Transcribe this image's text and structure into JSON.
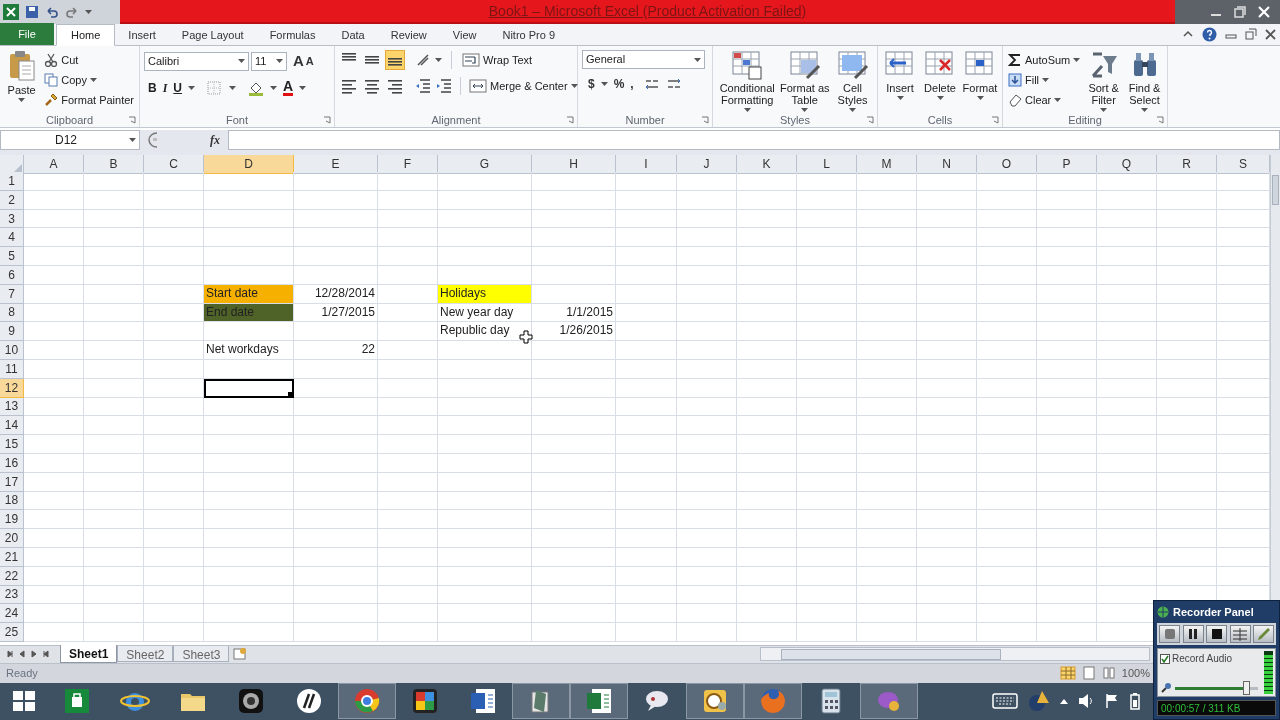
{
  "window": {
    "title": "Book1 – Microsoft Excel (Product Activation Failed)"
  },
  "tabs": [
    {
      "label": "File",
      "kind": "file",
      "selected": false
    },
    {
      "label": "Home",
      "kind": "tab",
      "selected": true
    },
    {
      "label": "Insert",
      "kind": "tab",
      "selected": false
    },
    {
      "label": "Page Layout",
      "kind": "tab",
      "selected": false
    },
    {
      "label": "Formulas",
      "kind": "tab",
      "selected": false
    },
    {
      "label": "Data",
      "kind": "tab",
      "selected": false
    },
    {
      "label": "Review",
      "kind": "tab",
      "selected": false
    },
    {
      "label": "View",
      "kind": "tab",
      "selected": false
    },
    {
      "label": "Nitro Pro 9",
      "kind": "tab",
      "selected": false
    }
  ],
  "ribbon": {
    "clipboard": {
      "label": "Clipboard",
      "paste": "Paste",
      "items": [
        "Cut",
        "Copy",
        "Format Painter"
      ]
    },
    "font": {
      "label": "Font",
      "font": "Calibri",
      "size": "11",
      "buttons": [
        {
          "kind": "grow",
          "label": "A"
        },
        {
          "kind": "shrink",
          "label": "A"
        },
        {
          "kind": "bold",
          "label": "B"
        },
        {
          "kind": "italic",
          "label": "I"
        },
        {
          "kind": "underline",
          "label": "U"
        },
        {
          "kind": "color",
          "label": "A"
        }
      ]
    },
    "alignment": {
      "label": "Alignment",
      "vertical": [
        {
          "kind": "top",
          "selected": false
        },
        {
          "kind": "middle",
          "selected": false
        },
        {
          "kind": "bottom",
          "selected": true
        }
      ],
      "wrap": "Wrap Text",
      "merge": "Merge & Center"
    },
    "number": {
      "label": "Number",
      "format": "General",
      "buttons": [
        "$",
        "%",
        ","
      ]
    },
    "styles": {
      "label": "Styles",
      "items": [
        "Conditional Formatting",
        "Format as Table",
        "Cell Styles"
      ]
    },
    "cells": {
      "label": "Cells",
      "items": [
        "Insert",
        "Delete",
        "Format"
      ]
    },
    "editing": {
      "label": "Editing",
      "items": [
        "AutoSum",
        "Fill",
        "Clear"
      ],
      "large": [
        "Sort & Filter",
        "Find & Select"
      ]
    }
  },
  "formula_bar": {
    "name_box": "D12",
    "function": "fx"
  },
  "sheet": {
    "columns": [
      "A",
      "B",
      "C",
      "D",
      "E",
      "F",
      "G",
      "H",
      "I",
      "J",
      "K",
      "L",
      "M",
      "N",
      "O",
      "P",
      "Q",
      "R",
      "S"
    ],
    "rows": [
      {
        "label": "1"
      },
      {
        "label": "2"
      },
      {
        "label": "3"
      },
      {
        "label": "4"
      },
      {
        "label": "5"
      },
      {
        "label": "6"
      },
      {
        "label": "7",
        "cells": {
          "D": {
            "text": "Start date",
            "kind": "text",
            "color": "#f6b100",
            "selected": false
          },
          "E": {
            "text": "12/28/2014",
            "kind": "number",
            "selected": false
          },
          "G": {
            "text": "Holidays",
            "kind": "text",
            "color": "#ffff00",
            "selected": false
          }
        }
      },
      {
        "label": "8",
        "cells": {
          "D": {
            "text": "End date",
            "kind": "text",
            "color": "#4f6228",
            "selected": false
          },
          "E": {
            "text": "1/27/2015",
            "kind": "number",
            "selected": false
          },
          "G": {
            "text": "New year day",
            "kind": "text",
            "selected": false
          },
          "H": {
            "text": "1/1/2015",
            "kind": "number",
            "selected": false
          }
        }
      },
      {
        "label": "9",
        "cells": {
          "G": {
            "text": "Republic day",
            "kind": "text",
            "selected": false
          },
          "H": {
            "text": "1/26/2015",
            "kind": "number",
            "selected": false
          }
        }
      },
      {
        "label": "10",
        "cells": {
          "D": {
            "text": "Net workdays",
            "kind": "text",
            "selected": false
          },
          "E": {
            "text": "22",
            "kind": "number",
            "selected": false
          }
        }
      },
      {
        "label": "11"
      },
      {
        "label": "12",
        "cells": {
          "D": {
            "kind": "empty",
            "selected": true
          }
        }
      },
      {
        "label": "13"
      },
      {
        "label": "14"
      },
      {
        "label": "15"
      },
      {
        "label": "16"
      },
      {
        "label": "17"
      },
      {
        "label": "18"
      },
      {
        "label": "19"
      },
      {
        "label": "20"
      },
      {
        "label": "21"
      },
      {
        "label": "22"
      },
      {
        "label": "23"
      },
      {
        "label": "24"
      },
      {
        "label": "25"
      }
    ]
  },
  "sheet_tabs": [
    {
      "label": "Sheet1",
      "selected": true
    },
    {
      "label": "Sheet2",
      "selected": false
    },
    {
      "label": "Sheet3",
      "selected": false
    }
  ],
  "status_bar": {
    "text": "Ready",
    "zoom": "100%"
  },
  "taskbar": {
    "apps": [
      {
        "kind": "start",
        "selected": false
      },
      {
        "kind": "store",
        "selected": false
      },
      {
        "kind": "ie",
        "selected": false
      },
      {
        "kind": "folder",
        "selected": false
      },
      {
        "kind": "camera",
        "selected": false
      },
      {
        "kind": "hp",
        "selected": false
      },
      {
        "kind": "chrome",
        "selected": true
      },
      {
        "kind": "tiles",
        "selected": false
      },
      {
        "kind": "word",
        "selected": false
      },
      {
        "kind": "notes",
        "selected": true
      },
      {
        "kind": "excel",
        "selected": true
      },
      {
        "kind": "chat",
        "selected": false
      },
      {
        "kind": "outlook",
        "selected": true
      },
      {
        "kind": "firefox",
        "selected": true
      },
      {
        "kind": "calculator",
        "selected": false
      },
      {
        "kind": "purple",
        "selected": true
      }
    ]
  },
  "recorder": {
    "title": "Recorder Panel",
    "record_audio": {
      "label": "Record Audio",
      "checked": true
    },
    "volume": {
      "level": 0.85
    },
    "meter": {
      "level": 0.9
    },
    "time": "00:00:57 / 311 KB"
  }
}
